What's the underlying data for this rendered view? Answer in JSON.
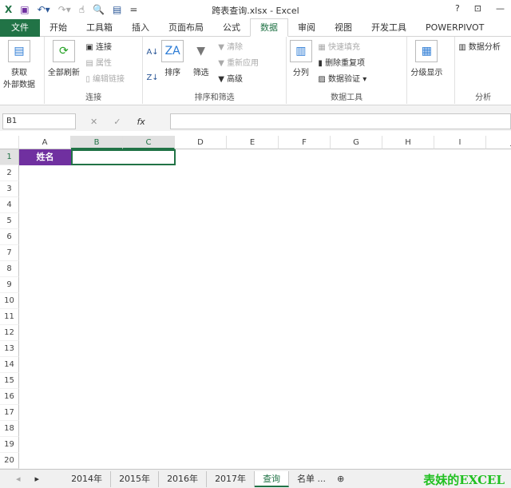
{
  "title": "跨表查询.xlsx - Excel",
  "window_controls": [
    "?",
    "⊡",
    "—"
  ],
  "tabs": [
    "文件",
    "开始",
    "工具箱",
    "插入",
    "页面布局",
    "公式",
    "数据",
    "审阅",
    "视图",
    "开发工具",
    "POWERPIVOT"
  ],
  "active_tab": "数据",
  "ribbon": {
    "get_external": "获取\n外部数据",
    "refresh_all": "全部刷新",
    "connections": "连接",
    "properties": "属性",
    "edit_links": "编辑链接",
    "group_connections": "连接",
    "sort": "排序",
    "filter": "筛选",
    "clear": "清除",
    "reapply": "重新应用",
    "advanced": "高级",
    "group_sort": "排序和筛选",
    "text_to_columns": "分列",
    "flash_fill": "快速填充",
    "remove_duplicates": "删除重复项",
    "data_validation": "数据验证",
    "group_tools": "数据工具",
    "outline": "分级显示",
    "data_analysis": "数据分析",
    "group_analysis": "分析"
  },
  "name_box": "B1",
  "fx": "fx",
  "columns": [
    "A",
    "B",
    "C",
    "D",
    "E",
    "F",
    "G",
    "H",
    "I",
    "J"
  ],
  "rows": [
    "1",
    "2",
    "3",
    "4",
    "5",
    "6",
    "7",
    "8",
    "9",
    "10",
    "11",
    "12",
    "13",
    "14",
    "15",
    "16",
    "17",
    "18",
    "19",
    "20"
  ],
  "cell_a1": "姓名",
  "sheets": [
    "2014年",
    "2015年",
    "2016年",
    "2017年",
    "查询",
    "名单 ..."
  ],
  "active_sheet": "查询",
  "watermark": "表妹的EXCEL",
  "accent": "#217346",
  "header_fill": "#7030a0"
}
